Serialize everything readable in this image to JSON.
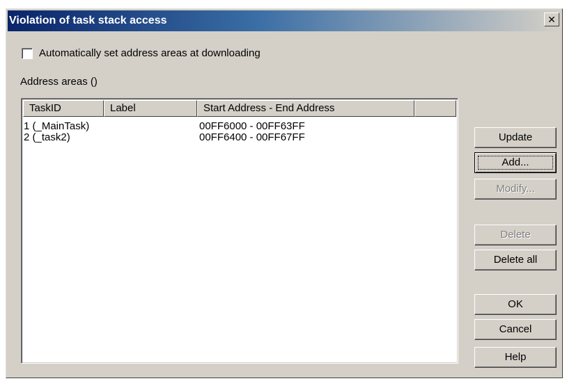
{
  "window": {
    "title": "Violation of task stack access",
    "close_glyph": "✕",
    "close_icon": "close-icon"
  },
  "options": {
    "auto_set_label": "Automatically set address areas at downloading",
    "auto_set_checked": false
  },
  "address_areas": {
    "label": "Address areas ()",
    "columns": [
      "TaskID",
      "Label",
      "Start Address - End Address",
      ""
    ],
    "rows": [
      {
        "task_id": "1 (_MainTask)",
        "label": "",
        "range": "00FF6000 - 00FF63FF"
      },
      {
        "task_id": "2 (_task2)",
        "label": "",
        "range": "00FF6400 - 00FF67FF"
      }
    ]
  },
  "buttons": {
    "update": "Update",
    "add": "Add...",
    "modify": "Modify...",
    "delete": "Delete",
    "delete_all": "Delete all",
    "ok": "OK",
    "cancel": "Cancel",
    "help": "Help"
  }
}
